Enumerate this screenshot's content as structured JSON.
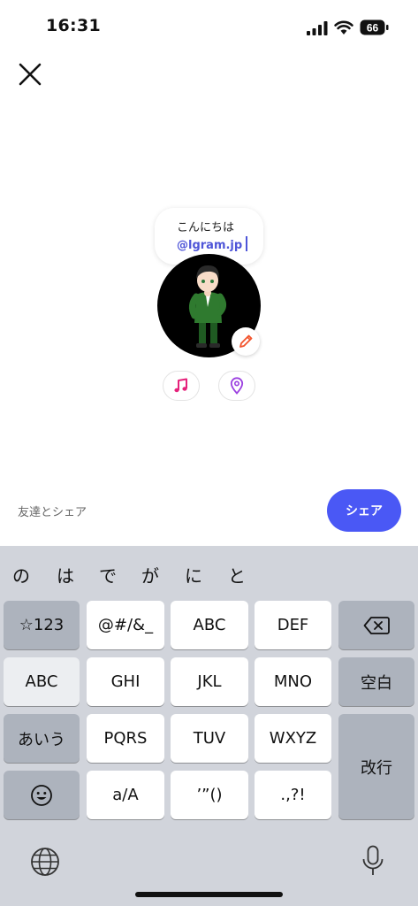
{
  "status_bar": {
    "time": "16:31",
    "battery": "66"
  },
  "bubble": {
    "greeting": "こんにちは",
    "mention": "@lgram.jp"
  },
  "share": {
    "label": "友達とシェア",
    "button_label": "シェア"
  },
  "keyboard": {
    "candidates": [
      "の",
      "は",
      "で",
      "が",
      "に",
      "と"
    ],
    "keys": {
      "numbers": "☆123",
      "symbols": "@#/&_",
      "abc_top": "ABC",
      "def": "DEF",
      "abc_mode": "ABC",
      "ghi": "GHI",
      "jkl": "JKL",
      "mno": "MNO",
      "space": "空白",
      "kana": "あいう",
      "pqrs": "PQRS",
      "tuv": "TUV",
      "wxyz": "WXYZ",
      "return": "改行",
      "case": "a/A",
      "quotes": "’”()",
      "punct": ".,?!"
    }
  },
  "icons": {
    "close": "close-icon",
    "edit": "pencil-icon",
    "music": "music-note-icon",
    "location": "location-pin-icon",
    "emoji": "emoji-icon",
    "backspace": "backspace-icon",
    "globe": "globe-icon",
    "mic": "microphone-icon"
  },
  "colors": {
    "accent": "#4a58f5",
    "mention": "#4e55d8",
    "music": "#e5227b",
    "location": "#9b3fe0",
    "edit": "#f2542d"
  }
}
